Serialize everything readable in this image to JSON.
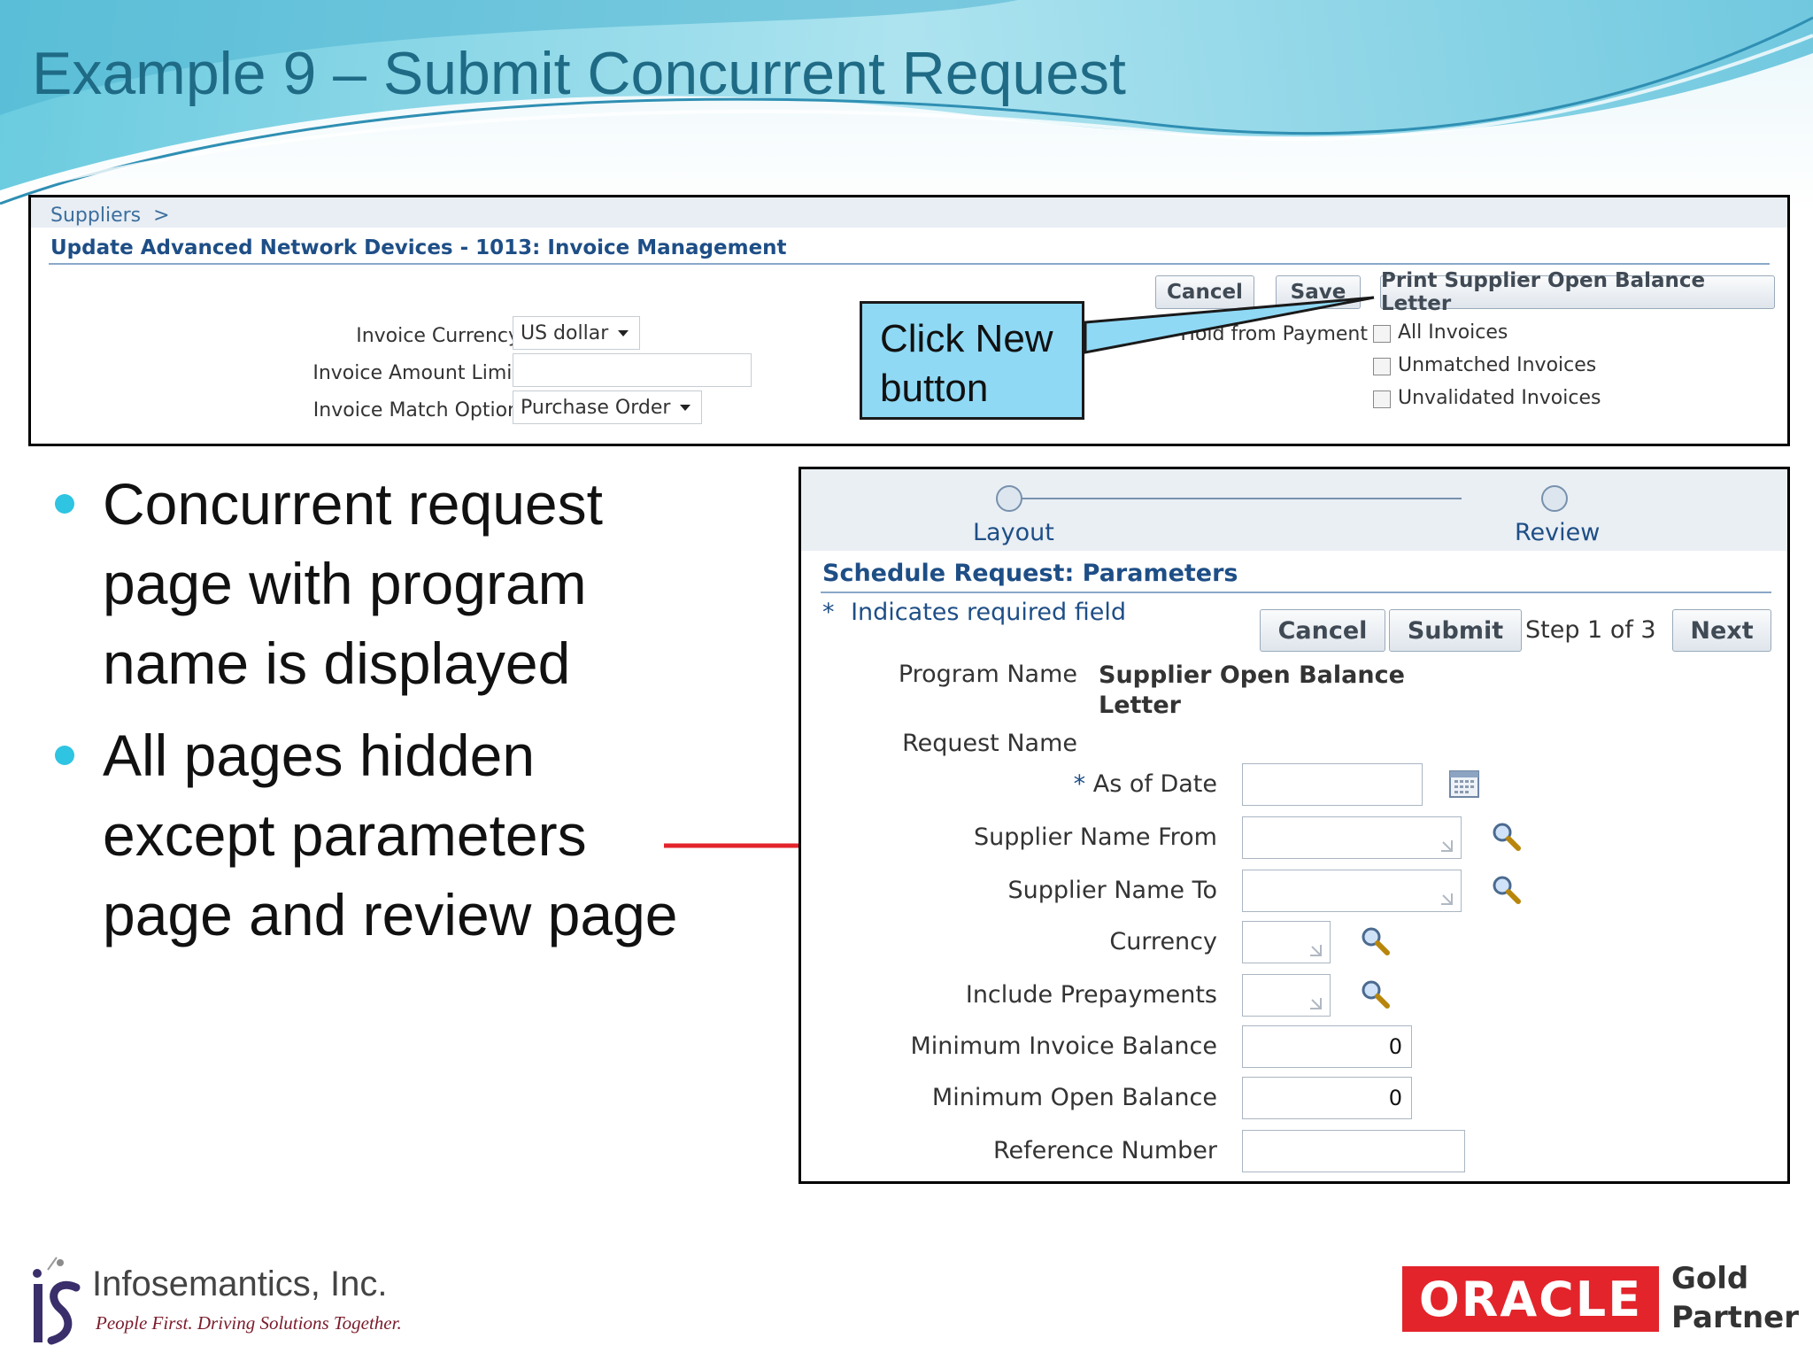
{
  "slide": {
    "title": "Example 9 – Submit Concurrent Request"
  },
  "top_screenshot": {
    "breadcrumb": "Suppliers  >",
    "page_heading": "Update Advanced Network Devices - 1013: Invoice Management",
    "buttons": {
      "cancel": "Cancel",
      "save": "Save",
      "print": "Print Supplier Open Balance Letter"
    },
    "fields": {
      "invoice_currency_label": "Invoice Currency",
      "invoice_currency_value": "US dollar",
      "invoice_amount_limit_label": "Invoice Amount Limit",
      "invoice_amount_limit_value": "",
      "invoice_match_option_label": "Invoice Match Option",
      "invoice_match_option_value": "Purchase Order"
    },
    "hold_from_payment_label": "Hold from Payment",
    "checkboxes": [
      "All Invoices",
      "Unmatched Invoices",
      "Unvalidated Invoices"
    ]
  },
  "callout": {
    "line1": "Click New",
    "line2": "button"
  },
  "bullets": [
    {
      "lines": [
        "Concurrent request",
        "page with program",
        "name is displayed"
      ]
    },
    {
      "lines": [
        "All pages hidden",
        "except parameters",
        "page and review page"
      ]
    }
  ],
  "bottom_screenshot": {
    "train": {
      "step1": "Layout",
      "step2": "Review"
    },
    "heading": "Schedule Request: Parameters",
    "required_note": "Indicates required field",
    "required_star": "*",
    "buttons": {
      "cancel": "Cancel",
      "submit": "Submit",
      "next": "Next"
    },
    "step_text": "Step 1 of 3",
    "program_name_label": "Program Name",
    "program_name_line1": "Supplier Open Balance",
    "program_name_line2": "Letter",
    "request_name_label": "Request Name",
    "params": {
      "as_of_date": "As of Date",
      "supplier_name_from": "Supplier Name From",
      "supplier_name_to": "Supplier Name To",
      "currency": "Currency",
      "include_prepayments": "Include Prepayments",
      "min_invoice_balance": "Minimum Invoice Balance",
      "min_invoice_balance_value": "0",
      "min_open_balance": "Minimum Open Balance",
      "min_open_balance_value": "0",
      "reference_number": "Reference Number"
    }
  },
  "footer": {
    "company_name": "Infosemantics, Inc.",
    "tagline": "People First. Driving Solutions Together.",
    "oracle": "ORACLE",
    "partner_line1": "Gold",
    "partner_line2": "Partner"
  },
  "colors": {
    "title": "#1f6b86",
    "callout_fill": "#8fd9f5",
    "arrow": "#e3242b",
    "bullet": "#2ec4e2",
    "oracle_red": "#e3242b"
  }
}
